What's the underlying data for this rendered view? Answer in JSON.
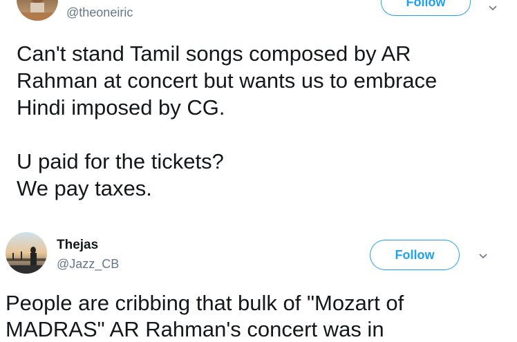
{
  "tweets": [
    {
      "handle": "@theoneiric",
      "follow_label": "Follow",
      "avatar_icon": "user-avatar-photo",
      "more_icon": "chevron-down-icon",
      "text": "Can't stand Tamil songs composed by AR\nRahman at concert but wants us to embrace\nHindi imposed by CG.\n\nU paid for the tickets?\nWe pay taxes."
    },
    {
      "display_name": "Thejas",
      "handle": "@Jazz_CB",
      "follow_label": "Follow",
      "avatar_icon": "user-avatar-photo",
      "more_icon": "chevron-down-icon",
      "text": "People are cribbing that bulk of \"Mozart of\nMADRAS\" AR Rahman's concert was in"
    }
  ],
  "colors": {
    "accent": "#1da1f2",
    "text_primary": "#14171a",
    "text_secondary": "#657786"
  }
}
